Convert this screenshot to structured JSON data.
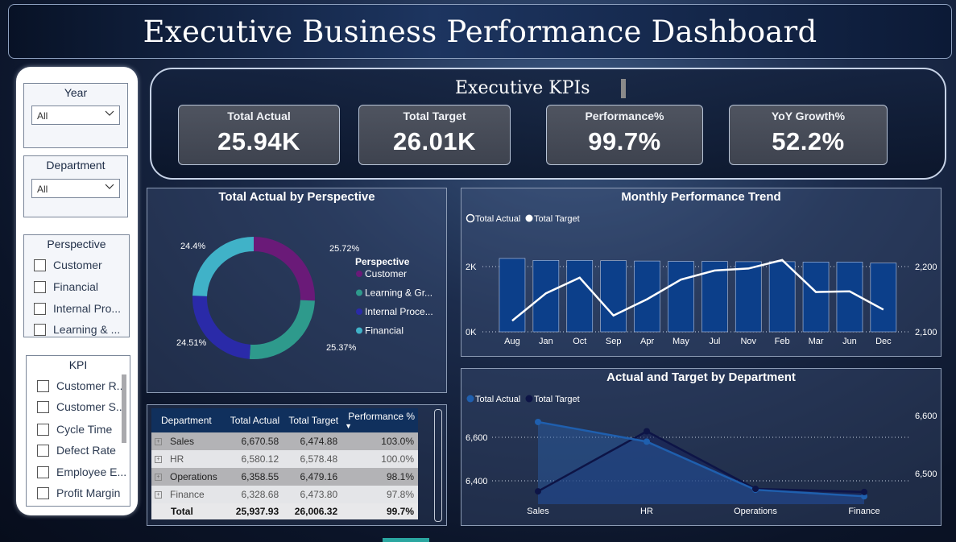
{
  "header": {
    "title": "Executive Business Performance Dashboard"
  },
  "slicers": {
    "year": {
      "title": "Year",
      "value": "All"
    },
    "department": {
      "title": "Department",
      "value": "All"
    },
    "perspective": {
      "title": "Perspective",
      "options": [
        "Customer",
        "Financial",
        "Internal Pro...",
        "Learning & ..."
      ]
    },
    "kpi": {
      "title": "KPI",
      "options": [
        "Customer R..",
        "Customer S..",
        "Cycle Time",
        "Defect Rate",
        "Employee E...",
        "Profit Margin"
      ]
    }
  },
  "kpis": {
    "heading": "Executive KPIs",
    "cards": [
      {
        "label": "Total Actual",
        "value": "25.94K"
      },
      {
        "label": "Total Target",
        "value": "26.01K"
      },
      {
        "label": "Performance%",
        "value": "99.7%"
      },
      {
        "label": "YoY Growth%",
        "value": "52.2%"
      }
    ]
  },
  "donut": {
    "title": "Total Actual by Perspective",
    "legend_title": "Perspective",
    "legend": [
      "Customer",
      "Learning & Gr...",
      "Internal Proce...",
      "Financial"
    ]
  },
  "trend": {
    "title": "Monthly Performance Trend",
    "legend": [
      "Total Actual",
      "Total Target"
    ],
    "left_ticks": [
      "2K",
      "0K"
    ],
    "right_ticks": [
      "2,200",
      "2,100"
    ]
  },
  "dept": {
    "title": "Actual and Target by Department",
    "legend": [
      "Total Actual",
      "Total Target"
    ],
    "left_ticks": [
      "6,600",
      "6,400"
    ],
    "right_ticks": [
      "6,600",
      "6,500"
    ]
  },
  "table": {
    "headers": [
      "Department",
      "Total Actual",
      "Total Target",
      "Performance %"
    ],
    "rows": [
      [
        "Sales",
        "6,670.58",
        "6,474.88",
        "103.0%"
      ],
      [
        "HR",
        "6,580.12",
        "6,578.48",
        "100.0%"
      ],
      [
        "Operations",
        "6,358.55",
        "6,479.16",
        "98.1%"
      ],
      [
        "Finance",
        "6,328.68",
        "6,473.80",
        "97.8%"
      ]
    ],
    "total": [
      "Total",
      "25,937.93",
      "26,006.32",
      "99.7%"
    ]
  },
  "chart_data": [
    {
      "type": "pie",
      "title": "Total Actual by Perspective",
      "categories": [
        "Customer",
        "Learning & Growth",
        "Internal Process",
        "Financial"
      ],
      "values": [
        25.72,
        25.37,
        24.51,
        24.4
      ],
      "value_labels": [
        "25.72%",
        "25.37%",
        "24.51%",
        "24.4%"
      ],
      "colors": [
        "#6a1a78",
        "#2e9a8c",
        "#2a2aa8",
        "#40b2c8"
      ],
      "legend": "right"
    },
    {
      "type": "bar",
      "title": "Monthly Performance Trend",
      "categories": [
        "Aug",
        "Jan",
        "Oct",
        "Sep",
        "Apr",
        "May",
        "Jul",
        "Nov",
        "Feb",
        "Mar",
        "Jun",
        "Dec"
      ],
      "series": [
        {
          "name": "Total Actual",
          "type": "bar",
          "axis": "left",
          "values": [
            2250,
            2190,
            2190,
            2180,
            2170,
            2160,
            2160,
            2150,
            2150,
            2140,
            2140,
            2110
          ]
        },
        {
          "name": "Total Target",
          "type": "line",
          "axis": "right",
          "values": [
            2117,
            2159,
            2183,
            2125,
            2150,
            2180,
            2194,
            2197,
            2210,
            2161,
            2162,
            2134
          ]
        }
      ],
      "ylim_left": [
        0,
        2000
      ],
      "ylim_right": [
        2100,
        2200
      ],
      "colors": {
        "bar": "#0c3f8a",
        "line": "#ffffff"
      },
      "legend": "top-left"
    },
    {
      "type": "area",
      "title": "Actual and Target by Department",
      "categories": [
        "Sales",
        "HR",
        "Operations",
        "Finance"
      ],
      "series": [
        {
          "name": "Total Actual",
          "axis": "left",
          "values": [
            6670.58,
            6580.12,
            6358.55,
            6328.68
          ]
        },
        {
          "name": "Total Target",
          "axis": "right",
          "values": [
            6474.88,
            6578.48,
            6479.16,
            6473.8
          ]
        }
      ],
      "ylim_left": [
        6400,
        6600
      ],
      "ylim_right": [
        6500,
        6600
      ],
      "colors": {
        "Total Actual": "#1f5fae",
        "Total Target": "#0d1446"
      },
      "legend": "top-left"
    }
  ]
}
